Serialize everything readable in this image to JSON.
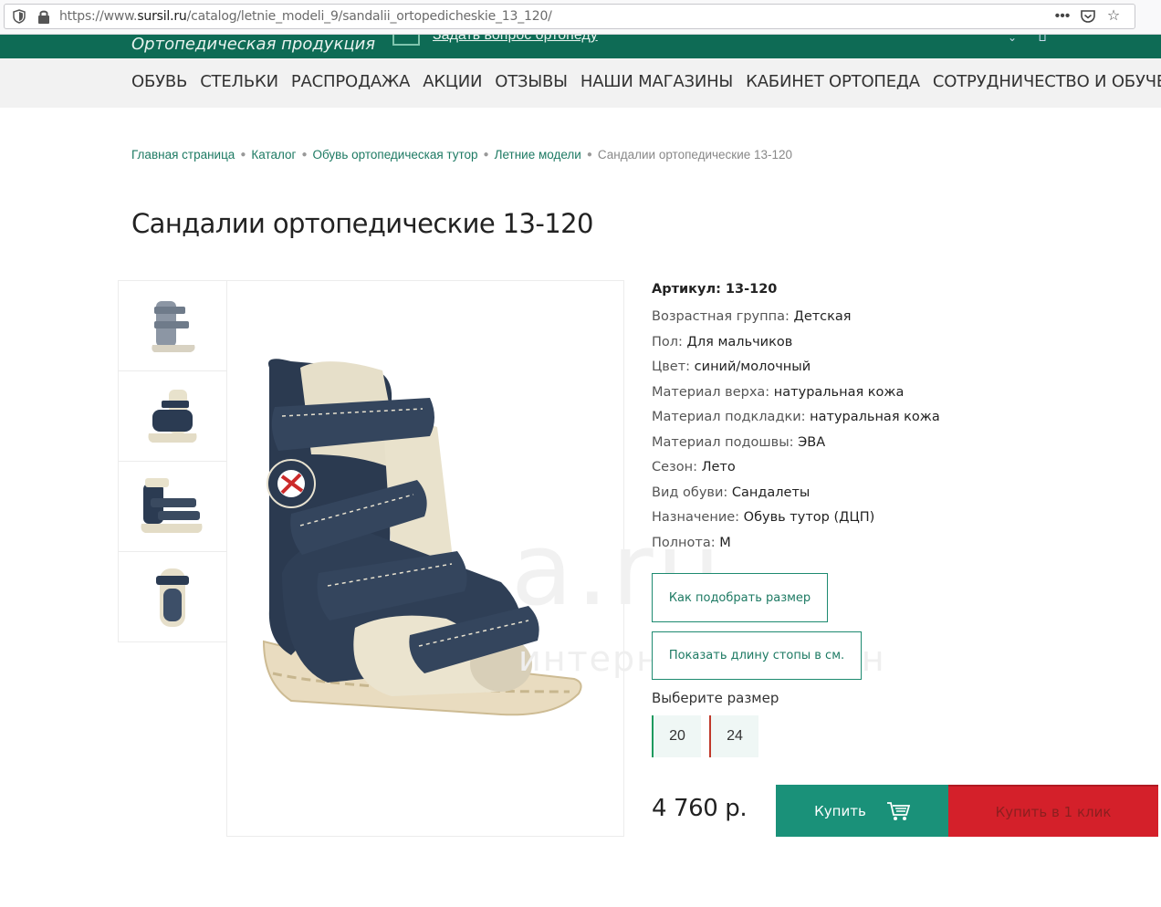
{
  "browser": {
    "url_prefix": "https://www.",
    "url_host": "sursil.ru",
    "url_path": "/catalog/letnie_modeli_9/sandalii_ortopedicheskie_13_120/"
  },
  "header": {
    "tagline": "Ортопедическая продукция",
    "ask_link": "Задать вопрос ортопеду"
  },
  "nav": {
    "items": [
      "ОБУВЬ",
      "СТЕЛЬКИ",
      "РАСПРОДАЖА",
      "АКЦИИ",
      "ОТЗЫВЫ",
      "НАШИ МАГАЗИНЫ",
      "КАБИНЕТ ОРТОПЕДА",
      "СОТРУДНИЧЕСТВО И ОБУЧЕНИЕ"
    ]
  },
  "breadcrumb": {
    "items": [
      "Главная страница",
      "Каталог",
      "Обувь ортопедическая тутор",
      "Летние модели"
    ],
    "current": "Сандалии ортопедические 13-120"
  },
  "product": {
    "title": "Сандалии ортопедические 13-120",
    "sku": "Артикул: 13-120",
    "specs": [
      {
        "label": "Возрастная группа: ",
        "value": "Детская"
      },
      {
        "label": "Пол: ",
        "value": "Для мальчиков"
      },
      {
        "label": "Цвет: ",
        "value": "синий/молочный"
      },
      {
        "label": "Материал верха: ",
        "value": "натуральная кожа"
      },
      {
        "label": "Материал подкладки: ",
        "value": "натуральная кожа"
      },
      {
        "label": "Материал подошвы: ",
        "value": "ЭВА"
      },
      {
        "label": "Сезон: ",
        "value": "Лето"
      },
      {
        "label": "Вид обуви: ",
        "value": "Сандалеты"
      },
      {
        "label": "Назначение: ",
        "value": "Обувь тутор (ДЦП)"
      },
      {
        "label": "Полнота: ",
        "value": "М"
      }
    ],
    "size_guide_label": "Как подобрать размер",
    "foot_length_label": "Показать длину стопы в см.",
    "choose_size_label": "Выберите размер",
    "sizes": [
      "20",
      "24"
    ],
    "price": "4 760 р.",
    "buy_label": "Купить",
    "buy_one_click_label": "Купить в 1 клик",
    "watermark": "a.ru",
    "watermark_sub": "интернет-аукцион"
  },
  "colors": {
    "brand_green": "#0e6b55",
    "buy_green": "#1a9179",
    "buy_red": "#d4202a"
  }
}
